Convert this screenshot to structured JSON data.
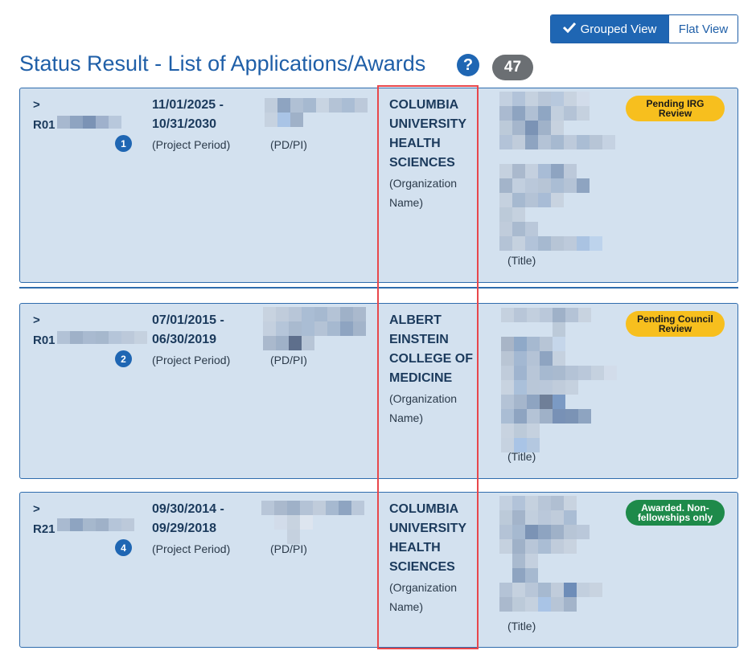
{
  "view_toggle": {
    "grouped_label": "Grouped View",
    "flat_label": "Flat View",
    "active": "grouped"
  },
  "header": {
    "title": "Status Result - List of Applications/Awards",
    "help_icon": "?",
    "count": "47"
  },
  "labels": {
    "project_period": "(Project Period)",
    "pd_pi": "(PD/PI)",
    "org_name": "(Organization Name)",
    "title": "(Title)"
  },
  "records": [
    {
      "chevron": ">",
      "grant_prefix": "R01",
      "badge_number": "1",
      "start_date": "11/01/2025 -",
      "end_date": "10/31/2030",
      "org": "COLUMBIA UNIVERSITY HEALTH SCIENCES",
      "status": "Pending IRG Review",
      "status_color": "#f7bf1e"
    },
    {
      "chevron": ">",
      "grant_prefix": "R01",
      "badge_number": "2",
      "start_date": "07/01/2015 -",
      "end_date": "06/30/2019",
      "org": "ALBERT EINSTEIN COLLEGE OF MEDICINE",
      "status": "Pending Council Review",
      "status_color": "#f7bf1e"
    },
    {
      "chevron": ">",
      "grant_prefix": "R21",
      "badge_number": "4",
      "start_date": "09/30/2014 -",
      "end_date": "09/29/2018",
      "org": "COLUMBIA UNIVERSITY HEALTH SCIENCES",
      "status": "Awarded. Non-fellowships only",
      "status_color": "#1e8a4a"
    }
  ],
  "colors": {
    "accent": "#1f66b3",
    "card_bg": "#d3e1ef",
    "highlight": "#e8474b",
    "count_badge": "#6b6f73"
  }
}
